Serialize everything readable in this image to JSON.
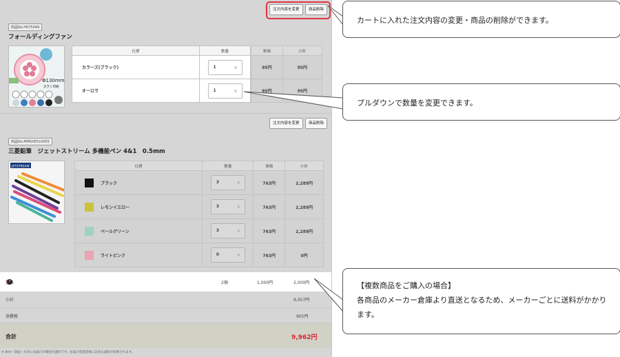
{
  "buttons": {
    "change_order": "注文内容を変更",
    "delete_item": "商品削除"
  },
  "products": [
    {
      "code": "商品No.H075049",
      "name": "フォールディングファン",
      "image_caption": "Φ130mm\n大きく印刷",
      "table_headers": [
        "仕様",
        "数量",
        "単価",
        "小計"
      ],
      "rows": [
        {
          "spec": "カラーズ(ブラック)",
          "qty": "1",
          "unit_price": "95円",
          "subtotal": "95円"
        },
        {
          "spec": "オーロラ",
          "qty": "1",
          "unit_price": "95円",
          "subtotal": "95円"
        }
      ]
    },
    {
      "code": "商品No.MMSXE510005",
      "name": "三菱鉛筆　ジェットストリーム 多機能ペン 4&1　0.5mm",
      "image_caption": "JETSTREAM",
      "table_headers": [
        "仕様",
        "数量",
        "単価",
        "小計"
      ],
      "rows": [
        {
          "spec": "ブラック",
          "color": "#111111",
          "qty": "3",
          "unit_price": "763円",
          "subtotal": "2,289円"
        },
        {
          "spec": "レモンイエロー",
          "color": "#c9c23a",
          "qty": "3",
          "unit_price": "763円",
          "subtotal": "2,289円"
        },
        {
          "spec": "ペールグリーン",
          "color": "#9fd2c0",
          "qty": "3",
          "unit_price": "763円",
          "subtotal": "2,289円"
        },
        {
          "spec": "ライトピンク",
          "color": "#e9a3b2",
          "qty": "0",
          "unit_price": "763円",
          "subtotal": "0円"
        }
      ]
    }
  ],
  "summary": {
    "shipping_label": "送料",
    "shipping_mark": "※",
    "shipping_count": "2個",
    "shipping_unit": "1,000円",
    "shipping_total": "2,000円",
    "subtotal_label": "小計",
    "subtotal_value": "9,057円",
    "tax_label": "消費税",
    "tax_value": "905円",
    "total_label": "合計",
    "total_value": "9,962円",
    "footnote": "※ 本州・四国・九州にお届けの場合の送料です。お届け先指定後に正式な送料が反映されます。"
  },
  "callouts": {
    "edit": "カートに入れた注文内容の変更・商品の削除ができます。",
    "quantity": "プルダウンで数量を変更できます。",
    "shipping_title": "【複数商品をご購入の場合】",
    "shipping_body": "各商品のメーカー倉庫より直送となるため、メーカーごとに送料がかかります。"
  },
  "colors": {
    "highlight": "#e1333f",
    "total_red": "#d9242f"
  }
}
